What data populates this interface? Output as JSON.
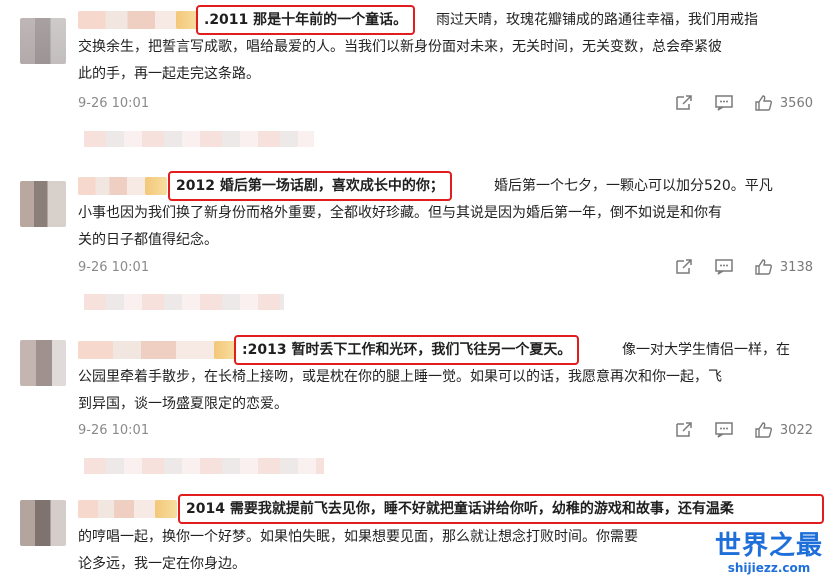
{
  "comments": [
    {
      "highlight": ".2011 那是十年前的一个童话。",
      "line1_rest": "雨过天晴，玫瑰花瓣铺成的路通往幸福，我们用戒指",
      "line2": "交换余生，把誓言写成歌，唱给最爱的人。当我们以新身份面对未来，无关时间，无关变数，总会牵紧彼",
      "line3": "此的手，再一起走完这条路。",
      "time": "9-26 10:01",
      "likes": "3560"
    },
    {
      "highlight": "2012 婚后第一场话剧，喜欢成长中的你；",
      "line1_rest": "婚后第一个七夕，一颗心可以加分520。平凡",
      "line2": "小事也因为我们换了新身份而格外重要，全都收好珍藏。但与其说是因为婚后第一年，倒不如说是和你有",
      "line3": "关的日子都值得纪念。",
      "time": "9-26 10:01",
      "likes": "3138"
    },
    {
      "highlight": ":2013 暂时丢下工作和光环，我们飞往另一个夏天。",
      "line1_rest": "像一对大学生情侣一样，在",
      "line2": "公园里牵着手散步，在长椅上接吻，或是枕在你的腿上睡一觉。如果可以的话，我愿意再次和你一起，飞",
      "line3": "到异国，谈一场盛夏限定的恋爱。",
      "time": "9-26 10:01",
      "likes": "3022"
    },
    {
      "highlight": "2014 需要我就提前飞去见你，睡不好就把童话讲给你听，幼稚的游戏和故事，还有温柔",
      "line1_rest": "",
      "line2": "的哼唱一起，换你一个好梦。如果怕失眠，如果想要见面，那么就让想念打败时间。你需要",
      "line3": "论多远，我一定在你身边。"
    }
  ],
  "watermark": {
    "main": "世界之最",
    "sub": "shijiezz.com"
  },
  "colors": {
    "highlight_border": "#e21d1d",
    "watermark": "#1e6fd9"
  }
}
